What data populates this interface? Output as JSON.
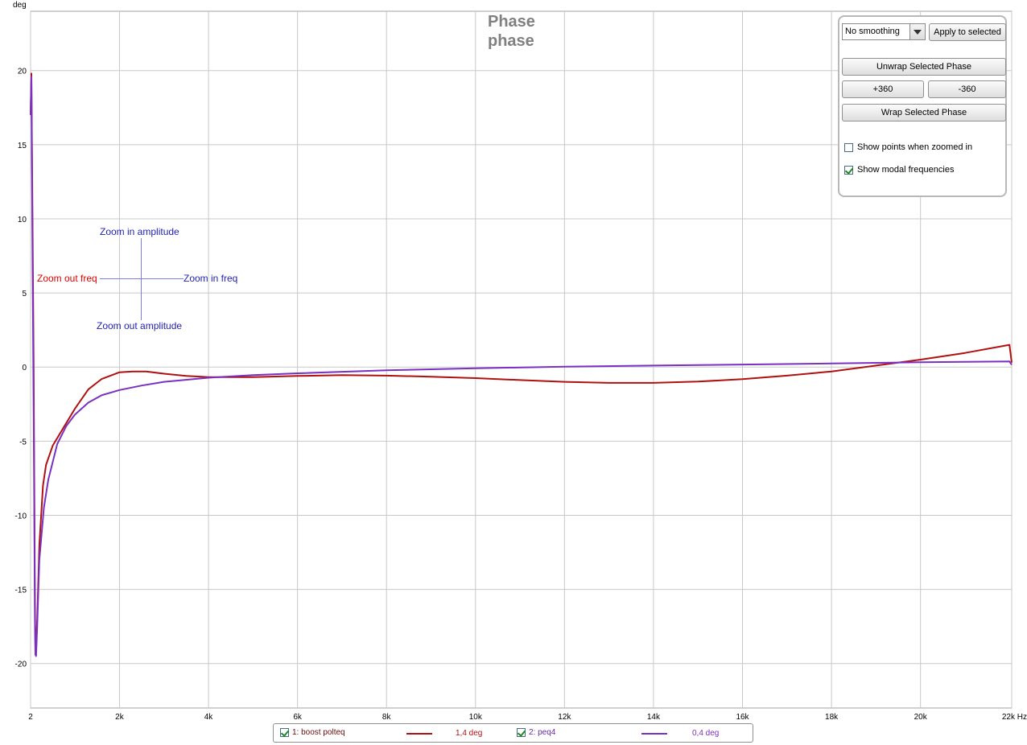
{
  "chart_data": {
    "type": "line",
    "title": "Phase",
    "subtitle": "phase",
    "ylabel": "deg",
    "xunit": "Hz",
    "xlim": [
      2,
      22050
    ],
    "ylim": [
      -23,
      24
    ],
    "grid": true,
    "x_ticks": [
      {
        "value": 2,
        "label": "2"
      },
      {
        "value": 2000,
        "label": "2k"
      },
      {
        "value": 4000,
        "label": "4k"
      },
      {
        "value": 6000,
        "label": "6k"
      },
      {
        "value": 8000,
        "label": "8k"
      },
      {
        "value": 10000,
        "label": "10k"
      },
      {
        "value": 12000,
        "label": "12k"
      },
      {
        "value": 14000,
        "label": "14k"
      },
      {
        "value": 16000,
        "label": "16k"
      },
      {
        "value": 18000,
        "label": "18k"
      },
      {
        "value": 20000,
        "label": "20k"
      },
      {
        "value": 22050,
        "label": "22k Hz"
      }
    ],
    "y_ticks": [
      {
        "value": 20,
        "label": "20"
      },
      {
        "value": 15,
        "label": "15"
      },
      {
        "value": 10,
        "label": "10"
      },
      {
        "value": 5,
        "label": "5"
      },
      {
        "value": 0,
        "label": "0"
      },
      {
        "value": -5,
        "label": "-5"
      },
      {
        "value": -10,
        "label": "-10"
      },
      {
        "value": -15,
        "label": "-15"
      },
      {
        "value": -20,
        "label": "-20"
      }
    ],
    "series": [
      {
        "name": "1: boost polteq",
        "color": "#b01010",
        "points": [
          [
            2,
            17
          ],
          [
            20,
            19.8
          ],
          [
            40,
            12
          ],
          [
            70,
            0
          ],
          [
            100,
            -16
          ],
          [
            110,
            -19
          ],
          [
            125,
            -19.2
          ],
          [
            150,
            -17
          ],
          [
            200,
            -12
          ],
          [
            280,
            -8
          ],
          [
            350,
            -6.6
          ],
          [
            500,
            -5.3
          ],
          [
            700,
            -4.3
          ],
          [
            1000,
            -2.8
          ],
          [
            1300,
            -1.5
          ],
          [
            1600,
            -0.8
          ],
          [
            2000,
            -0.35
          ],
          [
            2300,
            -0.3
          ],
          [
            2600,
            -0.3
          ],
          [
            3000,
            -0.45
          ],
          [
            3500,
            -0.6
          ],
          [
            4000,
            -0.68
          ],
          [
            5000,
            -0.68
          ],
          [
            6000,
            -0.6
          ],
          [
            7000,
            -0.55
          ],
          [
            8000,
            -0.58
          ],
          [
            9000,
            -0.65
          ],
          [
            10000,
            -0.75
          ],
          [
            11000,
            -0.88
          ],
          [
            12000,
            -1.0
          ],
          [
            13000,
            -1.07
          ],
          [
            14000,
            -1.07
          ],
          [
            15000,
            -0.98
          ],
          [
            16000,
            -0.82
          ],
          [
            17000,
            -0.58
          ],
          [
            18000,
            -0.3
          ],
          [
            19000,
            0.1
          ],
          [
            20000,
            0.5
          ],
          [
            21000,
            0.95
          ],
          [
            22000,
            1.5
          ],
          [
            22050,
            0.3
          ]
        ]
      },
      {
        "name": "2: peq4",
        "color": "#7a30c0",
        "points": [
          [
            2,
            17
          ],
          [
            20,
            19.6
          ],
          [
            40,
            10
          ],
          [
            70,
            -3
          ],
          [
            100,
            -17
          ],
          [
            110,
            -19.4
          ],
          [
            125,
            -19.5
          ],
          [
            150,
            -17.5
          ],
          [
            200,
            -13
          ],
          [
            300,
            -9.5
          ],
          [
            400,
            -7.6
          ],
          [
            600,
            -5.2
          ],
          [
            800,
            -4.0
          ],
          [
            1000,
            -3.2
          ],
          [
            1300,
            -2.4
          ],
          [
            1600,
            -1.9
          ],
          [
            2000,
            -1.55
          ],
          [
            2500,
            -1.25
          ],
          [
            3000,
            -1.0
          ],
          [
            4000,
            -0.72
          ],
          [
            5000,
            -0.55
          ],
          [
            6000,
            -0.42
          ],
          [
            8000,
            -0.22
          ],
          [
            10000,
            -0.08
          ],
          [
            12000,
            0.02
          ],
          [
            14000,
            0.1
          ],
          [
            16000,
            0.17
          ],
          [
            18000,
            0.24
          ],
          [
            20000,
            0.32
          ],
          [
            22000,
            0.38
          ],
          [
            22050,
            0.15
          ]
        ]
      }
    ]
  },
  "overlay": {
    "zoom_in_amplitude": "Zoom in amplitude",
    "zoom_out_amplitude": "Zoom out amplitude",
    "zoom_out_freq": "Zoom out freq",
    "zoom_in_freq": "Zoom in freq"
  },
  "panel": {
    "smoothing_value": "No  smoothing",
    "apply_label": "Apply to selected",
    "unwrap_label": "Unwrap Selected Phase",
    "plus360_label": "+360",
    "minus360_label": "-360",
    "wrap_label": "Wrap Selected Phase",
    "show_points_label": "Show points when zoomed in",
    "show_points_checked": false,
    "show_modal_label": "Show modal frequencies",
    "show_modal_checked": true
  },
  "legend": {
    "items": [
      {
        "label": "1: boost polteq",
        "value": "1,4 deg",
        "checked": true,
        "color": "#b01010",
        "text_color": "#6b0b0b"
      },
      {
        "label": "2: peq4",
        "value": "0,4 deg",
        "checked": true,
        "color": "#7a30c0",
        "text_color": "#6a2aa0"
      }
    ]
  }
}
